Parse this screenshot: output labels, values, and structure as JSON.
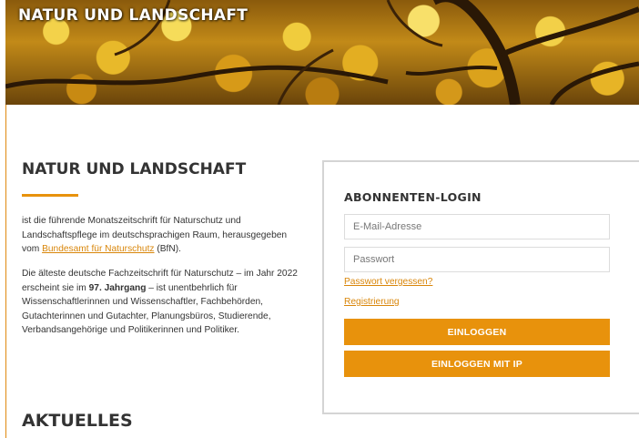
{
  "banner": {
    "title": "NATUR UND LANDSCHAFT"
  },
  "intro": {
    "heading": "NATUR UND LANDSCHAFT",
    "p1_before": "ist die führende Monatszeitschrift für Naturschutz und Landschaftspflege im deutschsprachigen Raum, herausgegeben vom ",
    "p1_link": "Bundesamt für Naturschutz",
    "p1_after": " (BfN).",
    "p2_before": "Die älteste deutsche Fachzeitschrift für Naturschutz – im Jahr 2022 erscheint sie im ",
    "p2_bold": "97. Jahrgang",
    "p2_after": " – ist unentbehrlich für Wissenschaftlerinnen und Wissenschaftler, Fachbehörden, Gutachterinnen und Gutachter, Planungsbüros, Studierende, Verbandsangehörige und Politikerinnen und Politiker."
  },
  "news": {
    "heading": "AKTUELLES"
  },
  "login": {
    "heading": "ABONNENTEN-LOGIN",
    "email_placeholder": "E-Mail-Adresse",
    "email_value": "",
    "password_placeholder": "Passwort",
    "password_value": "",
    "forgot_link": "Passwort vergessen?",
    "register_link": "Registrierung",
    "login_button": "EINLOGGEN",
    "login_ip_button": "EINLOGGEN MIT IP"
  },
  "colors": {
    "accent": "#e8920c",
    "link": "#d9860a",
    "text": "#333333",
    "border": "#d4d4d4"
  }
}
